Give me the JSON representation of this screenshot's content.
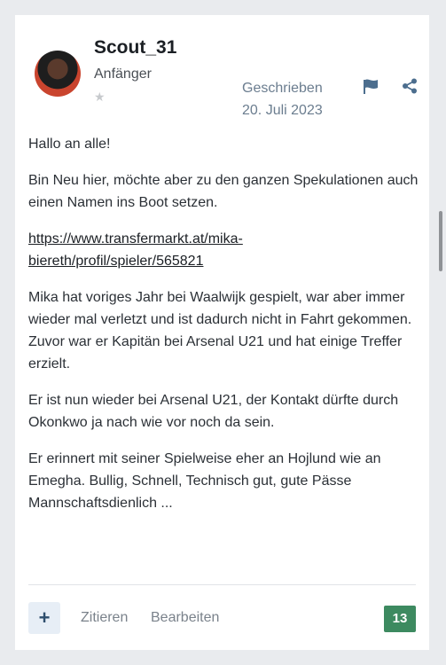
{
  "post": {
    "author": "Scout_31",
    "rank": "Anfänger",
    "rank_star": "★",
    "posted_label": "Geschrieben",
    "posted_date": "20. Juli 2023",
    "paragraphs": [
      "Hallo an alle!",
      "Bin Neu hier, möchte aber zu den ganzen Spekulationen auch einen Namen ins Boot setzen.",
      "Mika hat voriges Jahr bei Waalwijk gespielt, war aber immer wieder mal verletzt und ist dadurch nicht in Fahrt gekommen. Zuvor war er Kapitän bei Arsenal U21 und hat einige Treffer erzielt.",
      "Er ist nun wieder bei Arsenal U21, der Kontakt dürfte durch Okonkwo ja nach wie vor noch da sein.",
      "Er erinnert mit seiner Spielweise eher an Hojlund wie an Emegha. Bullig, Schnell, Technisch gut, gute Pässe Mannschaftsdienlich ..."
    ],
    "link_text": "https://www.transfermarkt.at/mika-biereth/profil/spieler/565821"
  },
  "footer": {
    "plus_label": "+",
    "quote_label": "Zitieren",
    "edit_label": "Bearbeiten",
    "reaction_count": "13"
  },
  "colors": {
    "reaction_badge": "#3d8a60",
    "accent": "#2e4e6d",
    "meta_text": "#6b7d8f"
  },
  "icons": [
    "flag-icon",
    "share-icon",
    "star-icon",
    "plus-icon"
  ]
}
